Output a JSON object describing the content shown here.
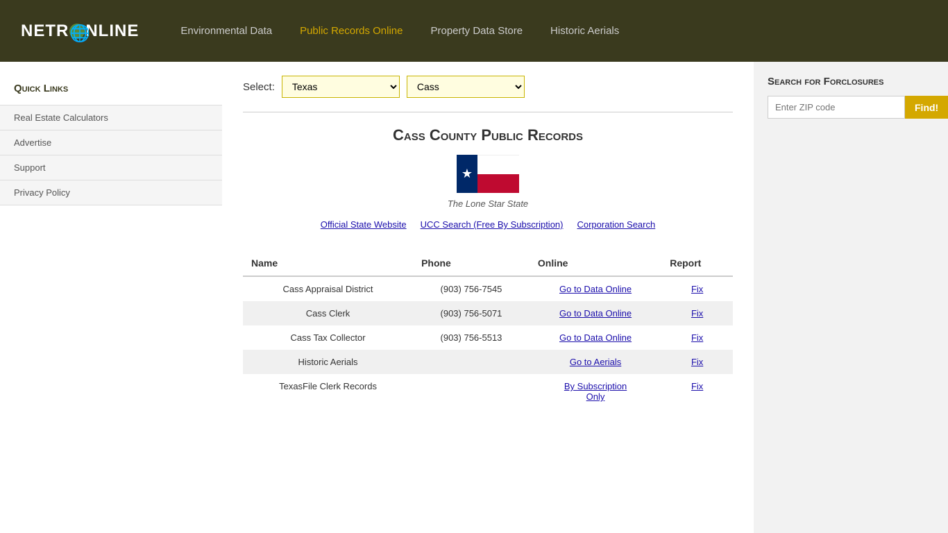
{
  "header": {
    "logo": "NETRONLINE",
    "nav": [
      {
        "label": "Environmental Data",
        "active": false
      },
      {
        "label": "Public Records Online",
        "active": true
      },
      {
        "label": "Property Data Store",
        "active": false
      },
      {
        "label": "Historic Aerials",
        "active": false
      }
    ]
  },
  "sidebar": {
    "title": "Quick Links",
    "items": [
      {
        "label": "Real Estate Calculators"
      },
      {
        "label": "Advertise"
      },
      {
        "label": "Support"
      },
      {
        "label": "Privacy Policy"
      }
    ]
  },
  "selector": {
    "label": "Select:",
    "state_value": "Texas",
    "county_value": "Cass",
    "state_options": [
      "Texas"
    ],
    "county_options": [
      "Cass"
    ]
  },
  "county": {
    "title": "Cass County Public Records",
    "state_caption": "The Lone Star State",
    "links": [
      {
        "label": "Official State Website"
      },
      {
        "label": "UCC Search (Free By Subscription)"
      },
      {
        "label": "Corporation Search"
      }
    ]
  },
  "table": {
    "headers": [
      "Name",
      "Phone",
      "Online",
      "Report"
    ],
    "rows": [
      {
        "name": "Cass Appraisal District",
        "phone": "(903) 756-7545",
        "online_label": "Go to Data Online",
        "report_label": "Fix"
      },
      {
        "name": "Cass Clerk",
        "phone": "(903) 756-5071",
        "online_label": "Go to Data Online",
        "report_label": "Fix"
      },
      {
        "name": "Cass Tax Collector",
        "phone": "(903) 756-5513",
        "online_label": "Go to Data Online",
        "report_label": "Fix"
      },
      {
        "name": "Historic Aerials",
        "phone": "",
        "online_label": "Go to Aerials",
        "report_label": "Fix"
      },
      {
        "name": "TexasFile Clerk Records",
        "phone": "",
        "online_label": "By Subscription Only",
        "report_label": "Fix"
      }
    ]
  },
  "right_sidebar": {
    "title": "Search for Forclosures",
    "zip_placeholder": "Enter ZIP code",
    "find_button": "Find!"
  }
}
